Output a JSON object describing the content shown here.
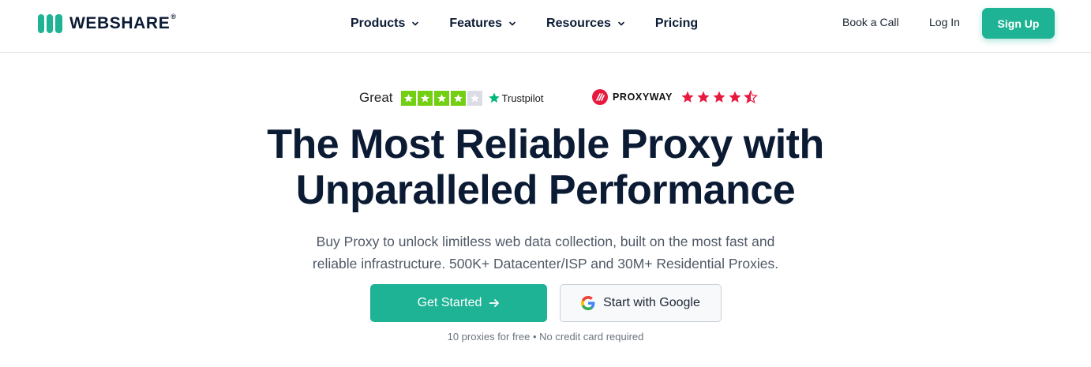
{
  "header": {
    "logo_text": "WEBSHARE",
    "logo_reg": "®",
    "nav": [
      {
        "label": "Products",
        "has_dropdown": true
      },
      {
        "label": "Features",
        "has_dropdown": true
      },
      {
        "label": "Resources",
        "has_dropdown": true
      },
      {
        "label": "Pricing",
        "has_dropdown": false
      }
    ],
    "book_call": "Book a Call",
    "login": "Log In",
    "signup": "Sign Up"
  },
  "ratings": {
    "trustpilot": {
      "word": "Great",
      "stars_filled": 4,
      "stars_total": 5,
      "brand": "Trustpilot"
    },
    "proxyway": {
      "brand": "PROXYWAY",
      "stars": 4.5,
      "stars_total": 5
    }
  },
  "hero": {
    "title_line1": "The Most Reliable Proxy with",
    "title_line2": "Unparalleled Performance",
    "subtitle_line1": "Buy Proxy to unlock limitless web data collection, built on the most fast and",
    "subtitle_line2": "reliable infrastructure. 500K+ Datacenter/ISP and 30M+ Residential Proxies.",
    "cta_primary": "Get Started",
    "cta_secondary": "Start with Google",
    "note": "10 proxies for free • No credit card required"
  },
  "colors": {
    "accent": "#1db394",
    "text_dark": "#0b1b34",
    "trustpilot_green": "#73cf11",
    "proxyway_red": "#e8193e"
  }
}
